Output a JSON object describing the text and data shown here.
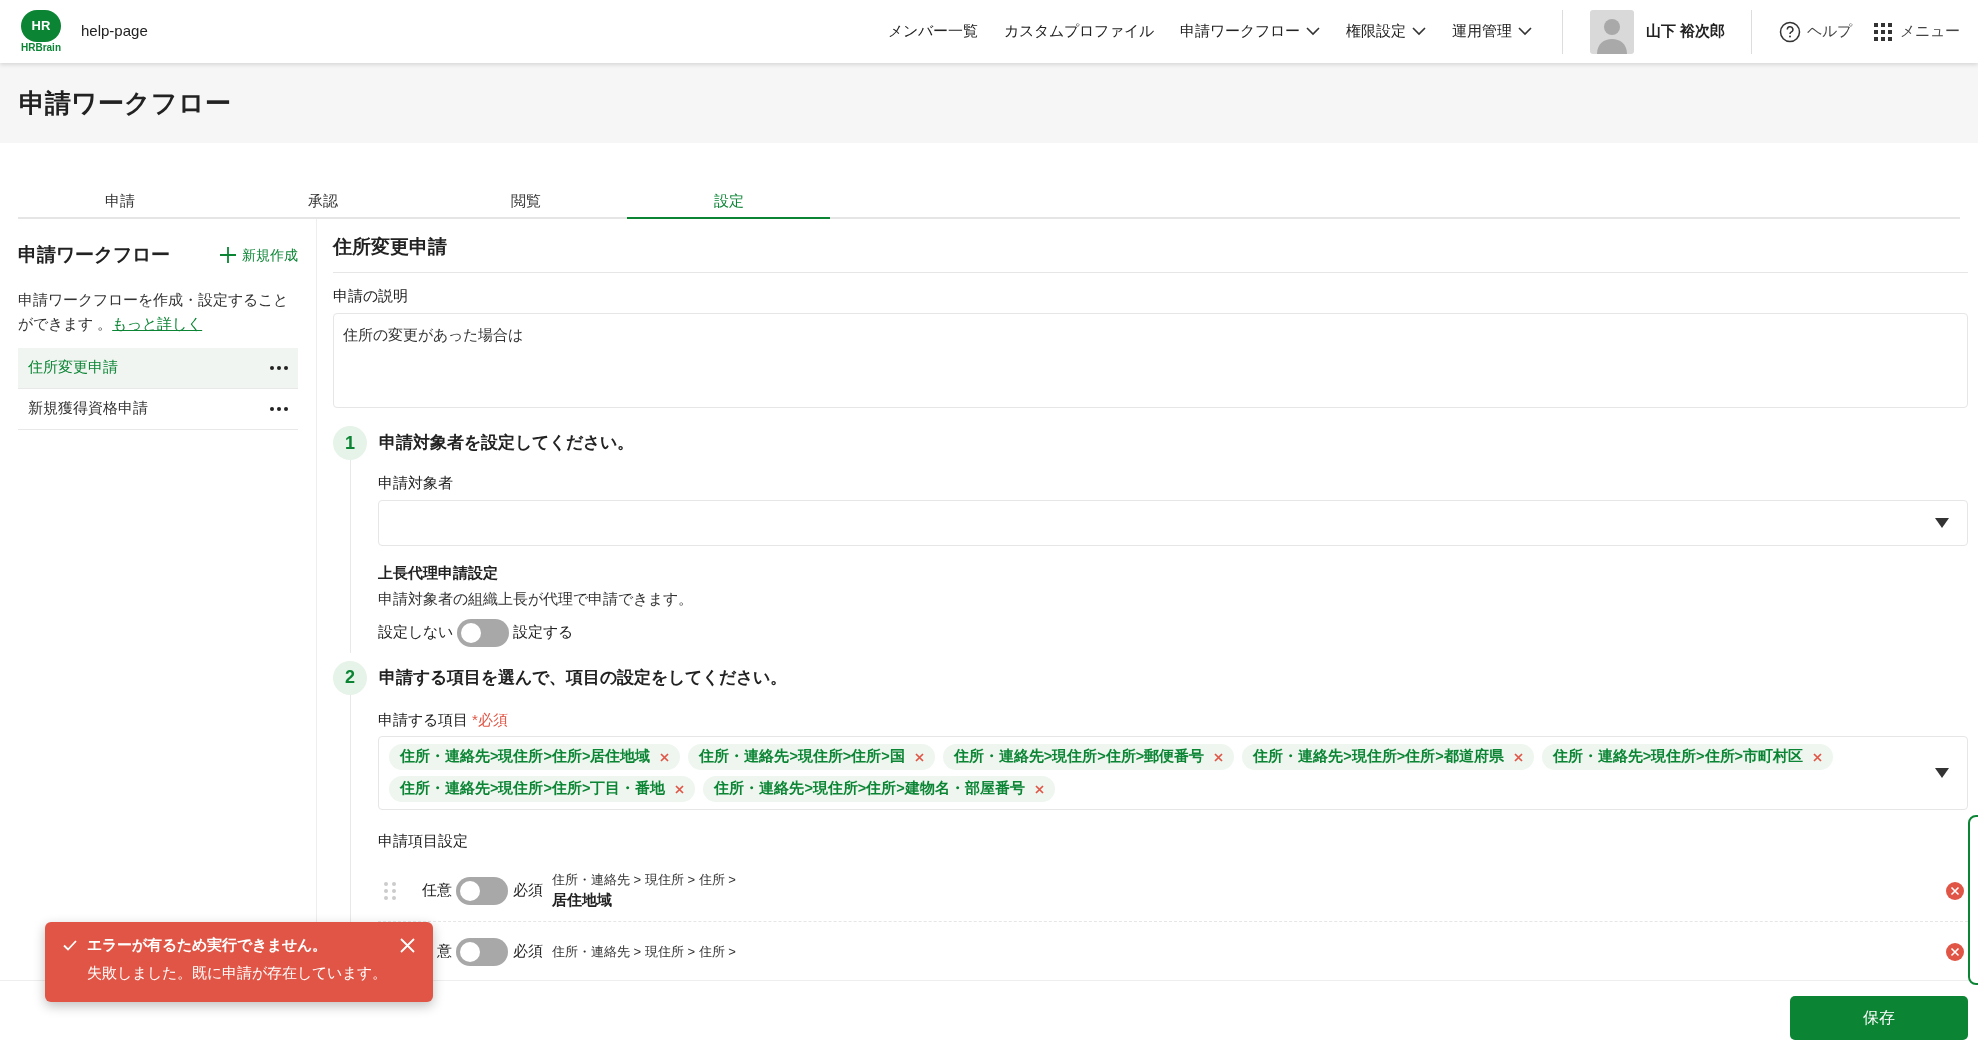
{
  "header": {
    "logo_mark": "HR",
    "logo_name": "HRBrain",
    "site": "help-page",
    "nav": [
      {
        "label": "メンバー一覧",
        "dropdown": false
      },
      {
        "label": "カスタムプロファイル",
        "dropdown": false
      },
      {
        "label": "申請ワークフロー",
        "dropdown": true
      },
      {
        "label": "権限設定",
        "dropdown": true
      },
      {
        "label": "運用管理",
        "dropdown": true
      }
    ],
    "user_name": "山下 裕次郎",
    "help": "ヘルプ",
    "menu": "メニュー"
  },
  "page_title": "申請ワークフロー",
  "tabs": [
    {
      "label": "申請",
      "selected": false
    },
    {
      "label": "承認",
      "selected": false
    },
    {
      "label": "閲覧",
      "selected": false
    },
    {
      "label": "設定",
      "selected": true
    }
  ],
  "sidebar": {
    "title": "申請ワークフロー",
    "new_button": "新規作成",
    "description": "申請ワークフローを作成・設定することができます 。",
    "more_link": "もっと詳しく",
    "items": [
      {
        "label": "住所変更申請",
        "selected": true
      },
      {
        "label": "新規獲得資格申請",
        "selected": false
      }
    ]
  },
  "form": {
    "title": "住所変更申請",
    "description_label": "申請の説明",
    "description_value": "住所の変更があった場合は"
  },
  "step1": {
    "number": "1",
    "title": "申請対象者を設定してください。",
    "target_label": "申請対象者",
    "proxy_title": "上長代理申請設定",
    "proxy_desc": "申請対象者の組織上長が代理で申請できます。",
    "proxy_off_label": "設定しない",
    "proxy_on_label": "設定する",
    "proxy_on": false
  },
  "step2": {
    "number": "2",
    "title": "申請する項目を選んで、項目の設定をしてください。",
    "items_label": "申請する項目",
    "required_mark": "*必須",
    "chips": [
      "住所・連絡先>現住所>住所>居住地域",
      "住所・連絡先>現住所>住所>国",
      "住所・連絡先>現住所>住所>郵便番号",
      "住所・連絡先>現住所>住所>都道府県",
      "住所・連絡先>現住所>住所>市町村区",
      "住所・連絡先>現住所>住所>丁目・番地",
      "住所・連絡先>現住所>住所>建物名・部屋番号"
    ],
    "settings_label": "申請項目設定",
    "rows": [
      {
        "optional_label": "任意",
        "required": false,
        "required_label": "必須",
        "path": "住所・連絡先 > 現住所 > 住所 >",
        "name": "居住地域"
      },
      {
        "optional_label": "意",
        "required": false,
        "required_label": "必須",
        "path": "住所・連絡先 > 現住所 > 住所 >"
      }
    ]
  },
  "toast": {
    "title": "エラーが有るため実行できません。",
    "message": "失敗しました。既に申請が存在しています。"
  },
  "save_button": "保存"
}
